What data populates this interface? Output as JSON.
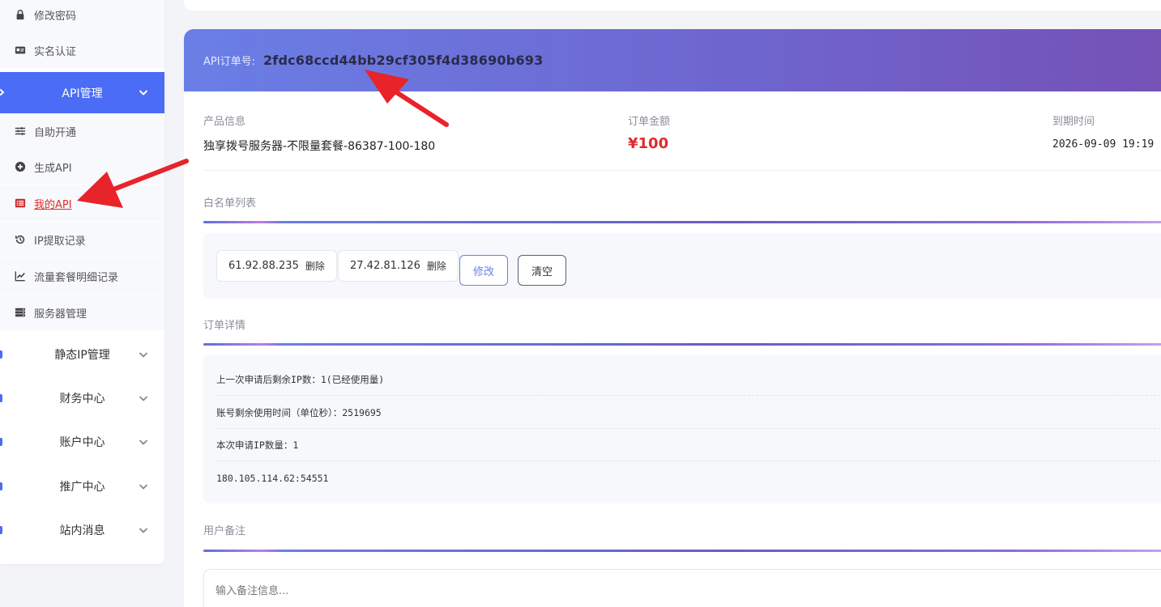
{
  "sidebar": {
    "sub_items_top": [
      {
        "label": "修改密码",
        "icon": "lock-icon"
      },
      {
        "label": "实名认证",
        "icon": "id-card-icon"
      }
    ],
    "api_group": {
      "label": "API管理",
      "icon": "chevron-down-icon"
    },
    "api_items": [
      {
        "label": "自助开通",
        "icon": "sliders-icon"
      },
      {
        "label": "生成API",
        "icon": "plus-circle-icon"
      },
      {
        "label": "我的API",
        "icon": "list-icon",
        "active": true
      },
      {
        "label": "IP提取记录",
        "icon": "history-icon"
      },
      {
        "label": "流量套餐明细记录",
        "icon": "line-chart-icon"
      },
      {
        "label": "服务器管理",
        "icon": "server-icon"
      }
    ],
    "groups": [
      {
        "label": "静态IP管理"
      },
      {
        "label": "财务中心"
      },
      {
        "label": "账户中心"
      },
      {
        "label": "推广中心"
      },
      {
        "label": "站内消息"
      }
    ]
  },
  "order": {
    "header_label": "API订单号:",
    "order_no": "2fdc68ccd44bb29cf305f4d38690b693",
    "product_label": "产品信息",
    "product_value": "独享拨号服务器-不限量套餐-86387-100-180",
    "amount_label": "订单金额",
    "amount_value": "¥100",
    "expire_label": "到期时间",
    "expire_value": "2026-09-09 19:19"
  },
  "whitelist": {
    "title": "白名单列表",
    "ips": [
      {
        "ip": "61.92.88.235",
        "delete": "删除"
      },
      {
        "ip": "27.42.81.126",
        "delete": "删除"
      }
    ],
    "edit_label": "修改",
    "clear_label": "清空"
  },
  "detail": {
    "title": "订单详情",
    "lines": [
      "上一次申请后剩余IP数：1(已经使用量)",
      "账号剩余使用时间（单位秒）：2519695",
      "本次申请IP数量：1",
      "180.105.114.62:54551"
    ]
  },
  "remark": {
    "title": "用户备注",
    "placeholder": "输入备注信息..."
  },
  "colors": {
    "accent": "#4a6cf7",
    "price": "#e02b2b",
    "header_gradient_start": "#6a7fe6",
    "header_gradient_end": "#7551b5",
    "annotation_arrow": "#e8232a"
  }
}
